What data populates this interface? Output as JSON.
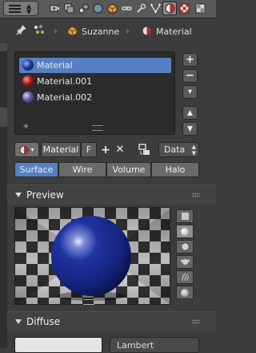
{
  "header": {
    "tabs": [
      {
        "icon": "render-icon"
      },
      {
        "icon": "render-layers-icon"
      },
      {
        "icon": "scene-icon"
      },
      {
        "icon": "world-icon"
      },
      {
        "icon": "object-icon"
      },
      {
        "icon": "constraints-icon"
      },
      {
        "icon": "modifiers-icon"
      },
      {
        "icon": "object-data-icon"
      },
      {
        "icon": "material-icon",
        "active": true
      },
      {
        "icon": "texture-icon"
      }
    ]
  },
  "breadcrumb": {
    "object": "Suzanne",
    "material": "Material"
  },
  "slots": [
    {
      "label": "Material",
      "selected": true,
      "color": "#1e3a9a"
    },
    {
      "label": "Material.001",
      "selected": false,
      "color": "#b01818"
    },
    {
      "label": "Material.002",
      "selected": false,
      "color": "#3a3a7a"
    }
  ],
  "side_buttons": {
    "add": "+",
    "remove": "−"
  },
  "datablock": {
    "name": "Material",
    "users_flag": "F",
    "new_symbol": "+",
    "unlink_symbol": "✕",
    "link": "Data"
  },
  "preview_types": [
    {
      "label": "Surface",
      "active": true
    },
    {
      "label": "Wire",
      "active": false
    },
    {
      "label": "Volume",
      "active": false
    },
    {
      "label": "Halo",
      "active": false
    }
  ],
  "panels": {
    "preview": "Preview",
    "diffuse": "Diffuse"
  },
  "diffuse": {
    "color": "#e6e6e6",
    "shader": "Lambert"
  },
  "colors": {
    "accent": "#5680c2",
    "panel_bg": "#3c3c3c",
    "sphere": "#1b2f8a"
  }
}
